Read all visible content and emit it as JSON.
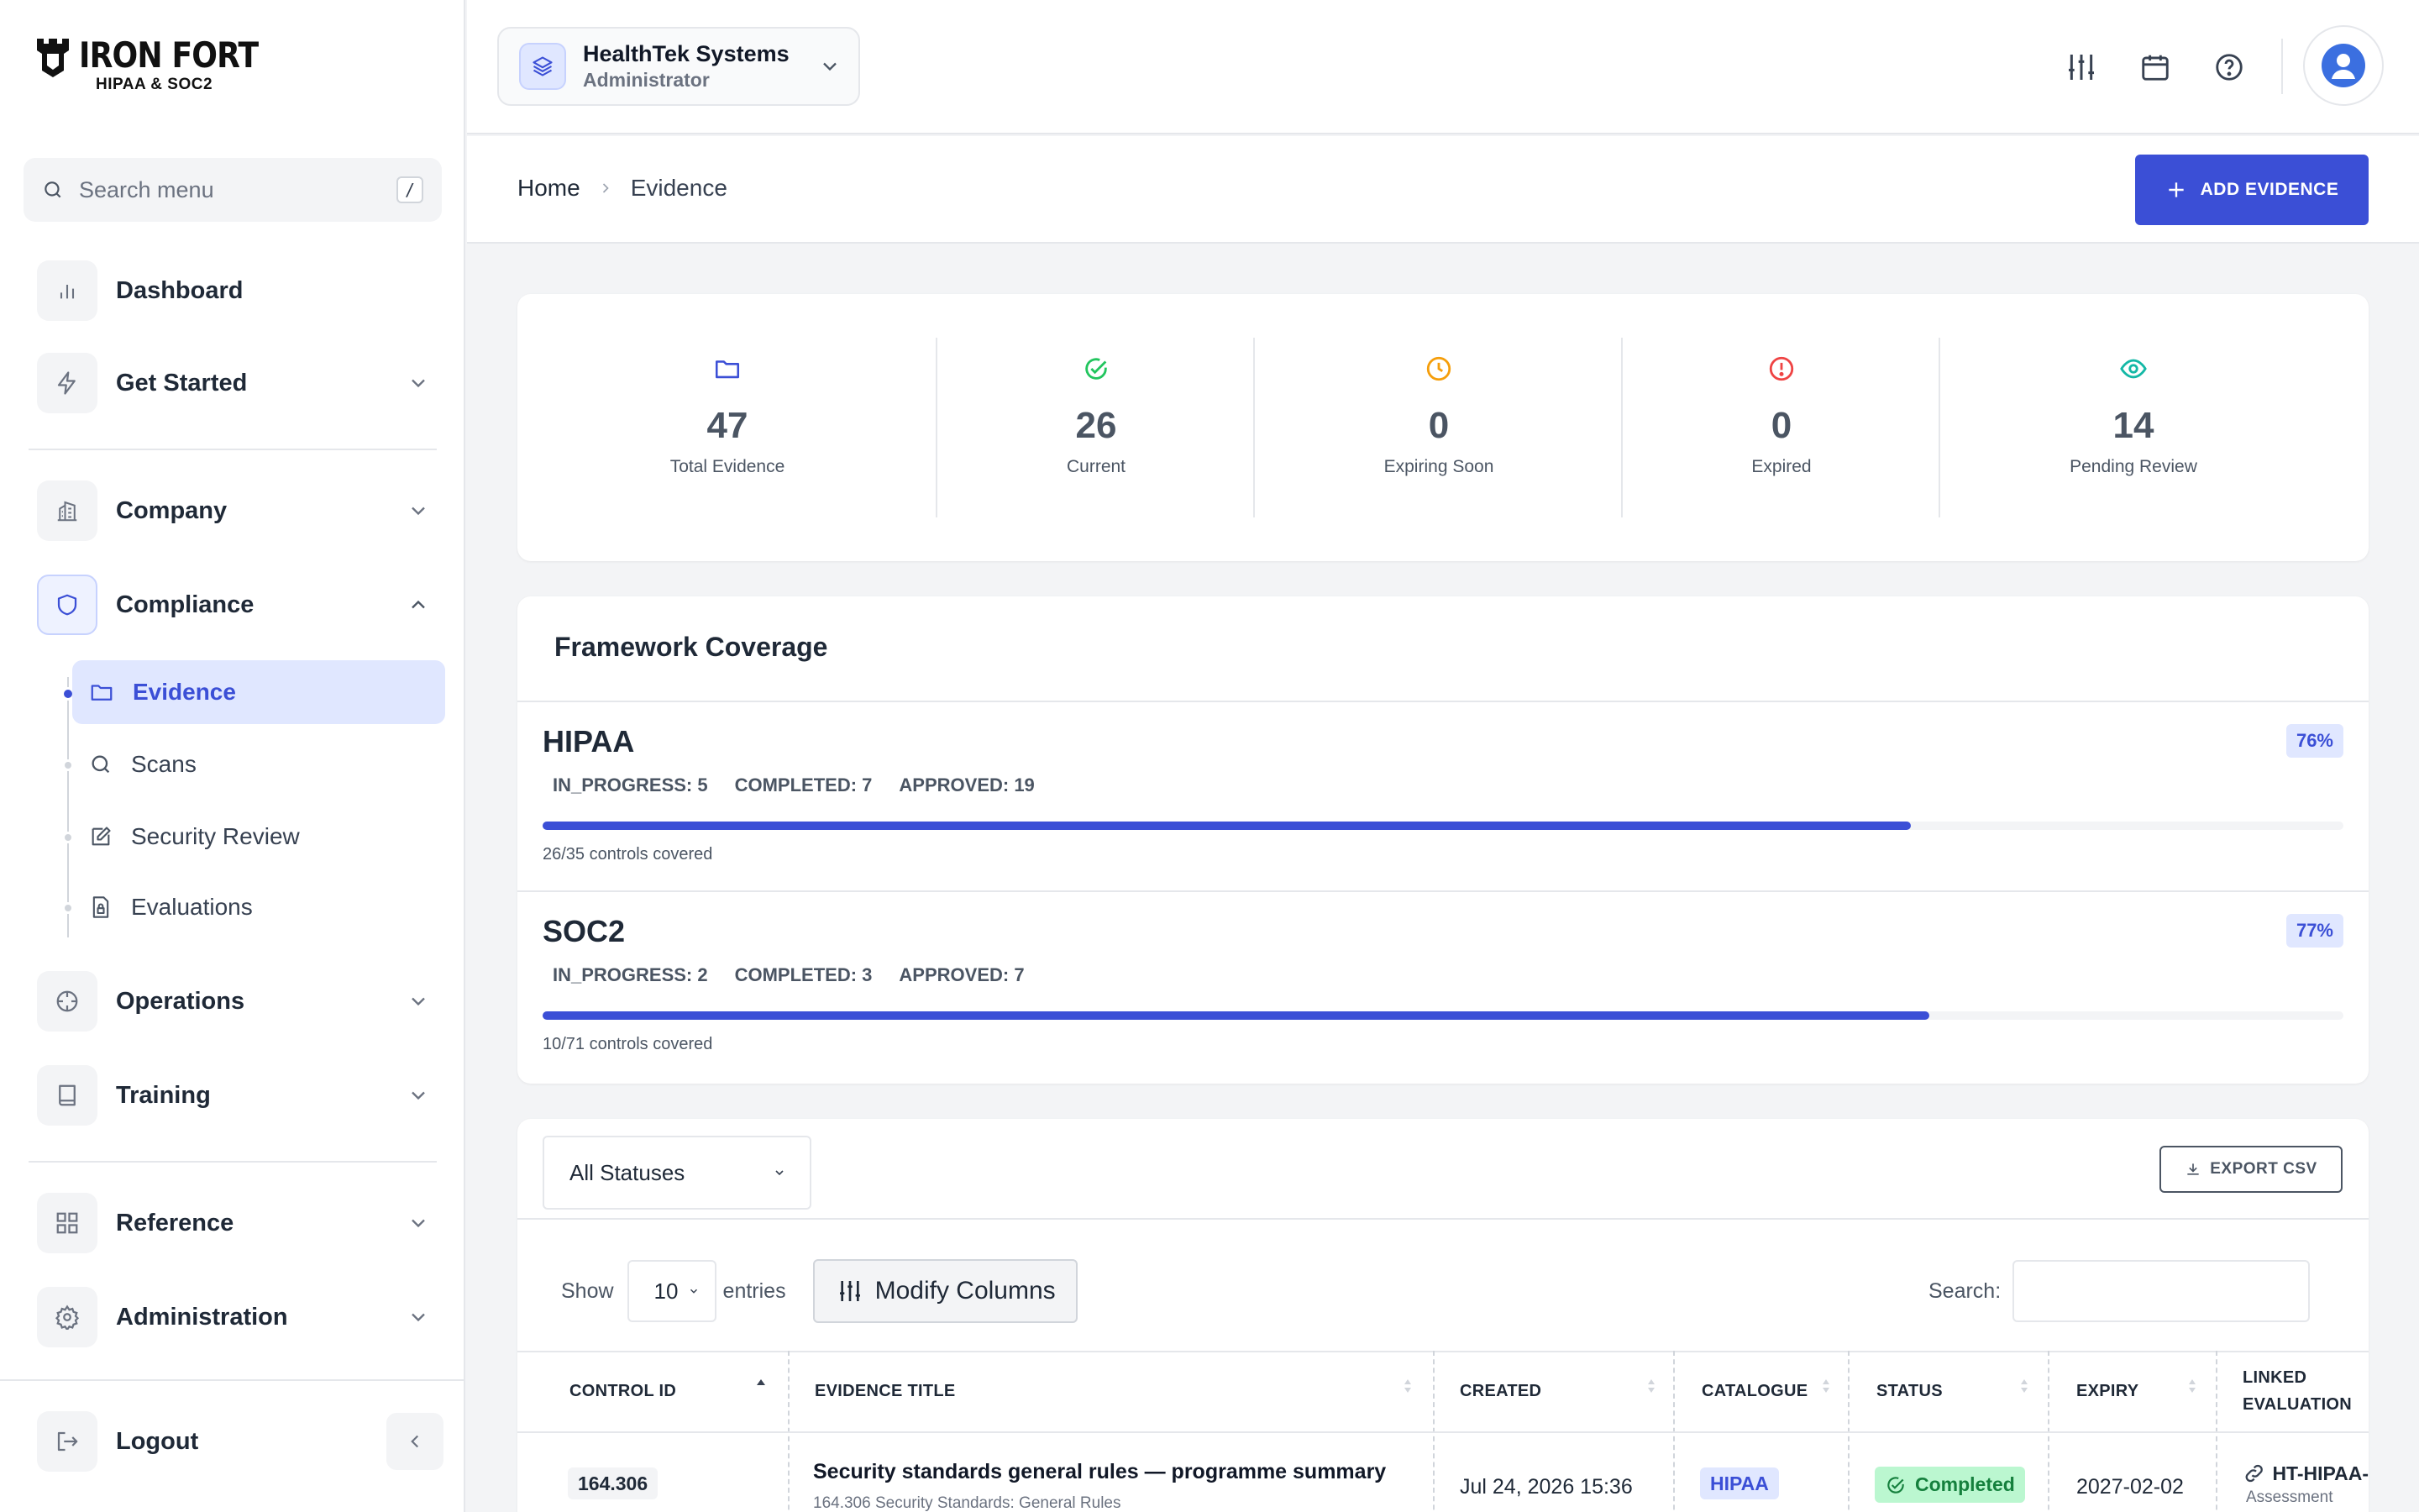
{
  "brand": {
    "name": "IRON FORT",
    "subtitle": "HIPAA & SOC2"
  },
  "sidebar": {
    "search_placeholder": "Search menu",
    "search_shortcut": "/",
    "items": {
      "dashboard": "Dashboard",
      "get_started": "Get Started",
      "company": "Company",
      "compliance": "Compliance",
      "operations": "Operations",
      "training": "Training",
      "reference": "Reference",
      "administration": "Administration",
      "logout": "Logout"
    },
    "compliance_sub": {
      "evidence": "Evidence",
      "scans": "Scans",
      "security_review": "Security Review",
      "evaluations": "Evaluations"
    },
    "active_item": "Evidence"
  },
  "header": {
    "org_name": "HealthTek Systems",
    "org_role": "Administrator",
    "icons": [
      "sliders-icon",
      "calendar-icon",
      "help-icon",
      "user-avatar-icon"
    ]
  },
  "breadcrumb": {
    "home": "Home",
    "current": "Evidence"
  },
  "actions": {
    "add_evidence": "ADD EVIDENCE",
    "export_csv": "EXPORT CSV"
  },
  "stats": [
    {
      "value": "47",
      "label": "Total Evidence",
      "icon": "folder-icon",
      "color": "#3b4fd6"
    },
    {
      "value": "26",
      "label": "Current",
      "icon": "check-circle-icon",
      "color": "#22c55e"
    },
    {
      "value": "0",
      "label": "Expiring Soon",
      "icon": "clock-icon",
      "color": "#f59e0b"
    },
    {
      "value": "0",
      "label": "Expired",
      "icon": "alert-circle-icon",
      "color": "#ef4444"
    },
    {
      "value": "14",
      "label": "Pending Review",
      "icon": "eye-icon",
      "color": "#14b8a6"
    }
  ],
  "coverage": {
    "title": "Framework Coverage",
    "frameworks": [
      {
        "name": "HIPAA",
        "percent_label": "76%",
        "in_progress": "IN_PROGRESS: 5",
        "completed": "COMPLETED: 7",
        "approved": "APPROVED: 19",
        "covered": "26/35 controls covered",
        "fill": 0.76
      },
      {
        "name": "SOC2",
        "percent_label": "77%",
        "in_progress": "IN_PROGRESS: 2",
        "completed": "COMPLETED: 3",
        "approved": "APPROVED: 7",
        "covered": "10/71 controls covered",
        "fill": 0.77
      }
    ]
  },
  "table": {
    "status_filter": "All Statuses",
    "show_label": "Show",
    "page_length": "10",
    "entries_label": "entries",
    "modify_columns": "Modify Columns",
    "search_label": "Search:",
    "columns": [
      "CONTROL ID",
      "EVIDENCE TITLE",
      "CREATED",
      "CATALOGUE",
      "STATUS",
      "EXPIRY",
      "LINKED",
      "EVALUATION"
    ],
    "rows": [
      {
        "control_id": "164.306",
        "title": "Security standards general rules — programme summary",
        "subtitle": "164.306 Security Standards: General Rules",
        "created": "Jul 24, 2026 15:36",
        "catalogue": "HIPAA",
        "status": "Completed",
        "expiry": "2027-02-02",
        "linked": "HT-HIPAA-",
        "linked_sub": "Assessment"
      }
    ]
  },
  "accent_color": "#3b4fd6"
}
